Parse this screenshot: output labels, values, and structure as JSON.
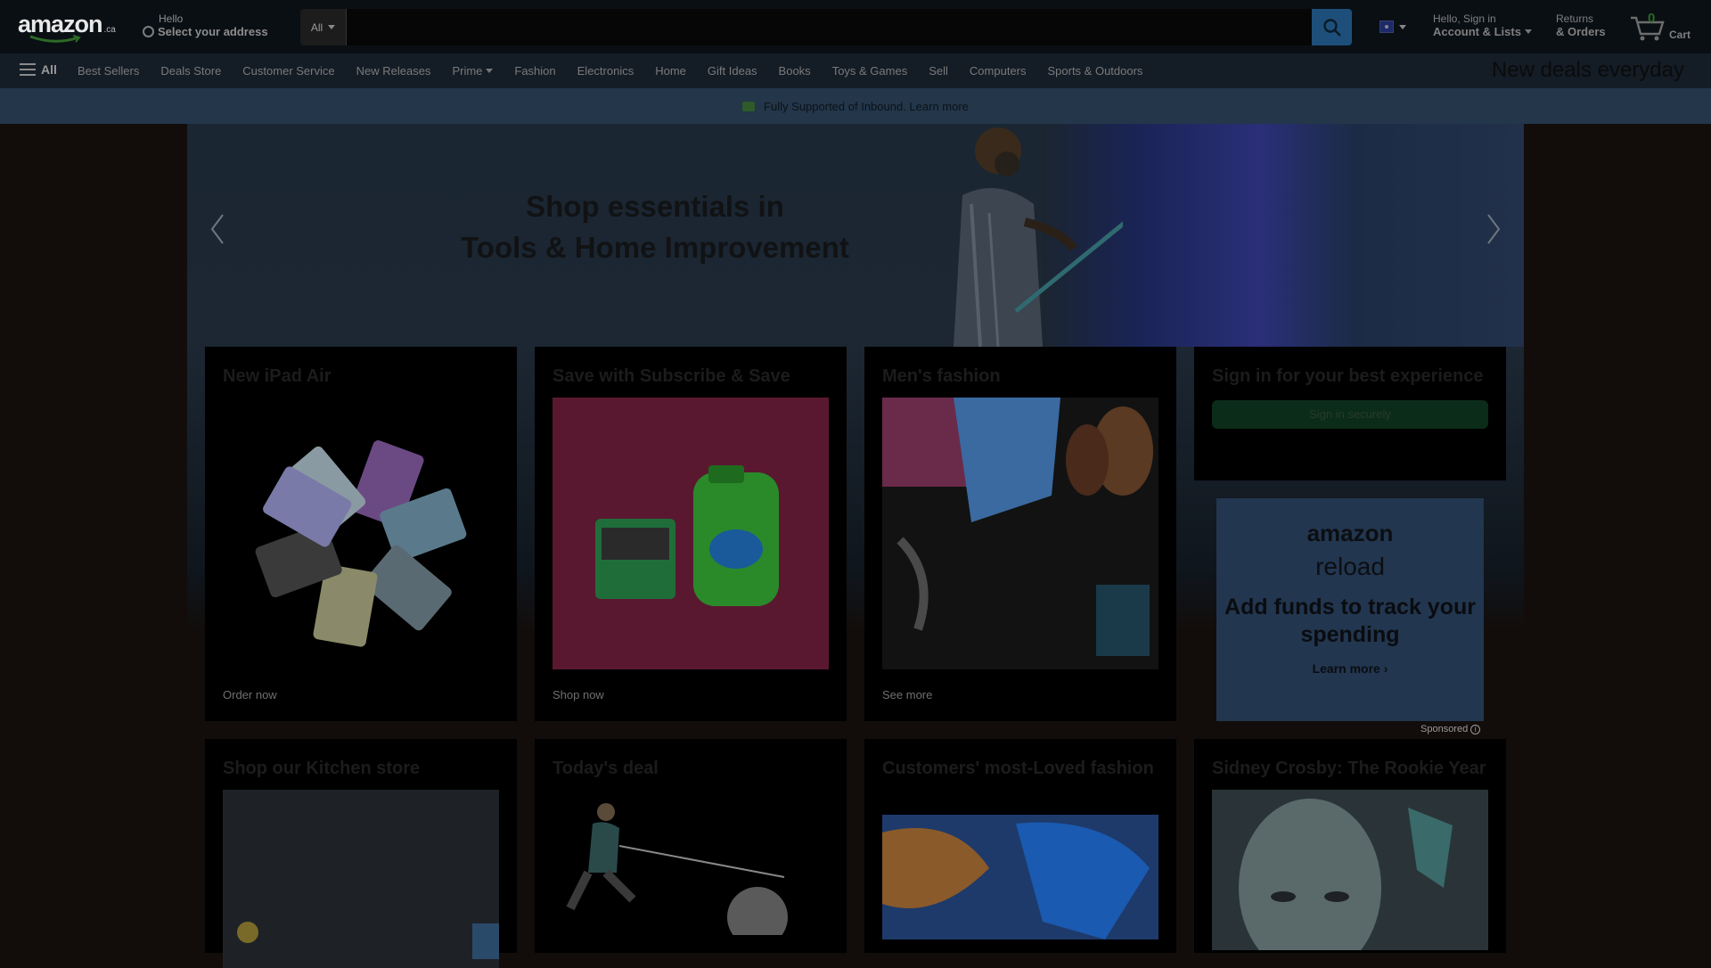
{
  "header": {
    "logo_text": "amazon",
    "logo_tld": ".ca",
    "deliver_line1": "Hello",
    "deliver_line2": "Select your address",
    "search_category": "All",
    "search_placeholder": "",
    "account_line1": "Hello, Sign in",
    "account_line2": "Account & Lists",
    "orders_line1": "Returns",
    "orders_line2": "& Orders",
    "cart_count": "0",
    "cart_label": "Cart"
  },
  "nav": {
    "all_label": "All",
    "items": [
      "Best Sellers",
      "Deals Store",
      "Customer Service",
      "New Releases",
      "Prime",
      "Fashion",
      "Electronics",
      "Home",
      "Gift Ideas",
      "Books",
      "Toys & Games",
      "Sell",
      "Computers",
      "Sports & Outdoors"
    ],
    "promo": "New deals everyday"
  },
  "notice": {
    "text": "Fully Supported of Inbound.  Learn more"
  },
  "hero": {
    "title_line1": "Shop essentials in",
    "title_line2": "Tools & Home Improvement"
  },
  "cards": [
    {
      "title": "New iPad Air",
      "link": "Order now"
    },
    {
      "title": "Save with Subscribe & Save",
      "link": "Shop now"
    },
    {
      "title": "Men's fashion",
      "link": "See more"
    },
    {
      "title": "Sign in for your best experience",
      "button": "Sign in securely"
    },
    {
      "title": "Shop our Kitchen store"
    },
    {
      "title": "Today's deal"
    },
    {
      "title": "Customers' most-Loved fashion"
    },
    {
      "title": "Sidney Crosby: The Rookie Year"
    }
  ],
  "reload_ad": {
    "brand": "amazon",
    "product": "reload",
    "headline": "Add funds to track your spending",
    "cta": "Learn more ›",
    "sponsored": "Sponsored"
  },
  "colors": {
    "header_bg": "#0a0f14",
    "nav_bg": "#141c26",
    "notice_bg": "#23364a",
    "search_button": "#1d4f7a",
    "card_bg": "#000000",
    "reload_bg": "#22364f",
    "signin_button": "#0b2c18"
  }
}
